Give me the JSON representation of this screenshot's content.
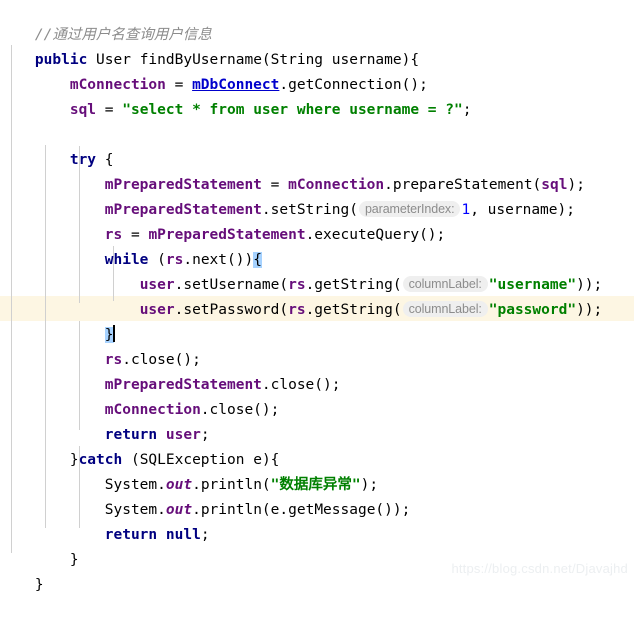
{
  "editor": {
    "language": "Java",
    "theme": "IntelliJ Light",
    "colors": {
      "background": "#ffffff",
      "keyword": "#000080",
      "string": "#008000",
      "number": "#0000ff",
      "field": "#660e7a",
      "comment": "#8c8c8c",
      "identifier": "#000000",
      "link": "#0000cc",
      "caret_line_highlight": "#fdf6e3",
      "brace_match_highlight": "#a6d2ff",
      "indent_guide": "#d0d0d0",
      "hint_chip_background": "#efefef",
      "hint_chip_text": "#8c8c8c",
      "watermark": "#eceff1"
    },
    "caret_line_number": 12,
    "matched_braces": [
      "{",
      "}"
    ]
  },
  "code": {
    "comment_line": "//通过用户名查询用户信息",
    "tokens": {
      "kw_public": "public",
      "kw_try": "try",
      "kw_while": "while",
      "kw_catch": "catch",
      "kw_return": "return",
      "kw_null": "null",
      "type_User": "User",
      "type_String": "String",
      "type_SQLException": "SQLException",
      "method_name": "findByUsername",
      "param_username": "username",
      "field_mConnection": "mConnection",
      "field_sql": "sql",
      "field_mPreparedStatement": "mPreparedStatement",
      "field_rs": "rs",
      "link_mDbConnect": "mDbConnect",
      "call_getConnection": ".getConnection();",
      "call_prepareStatement": ".prepareStatement(",
      "call_setString": ".setString(",
      "call_executeQuery": ".executeQuery();",
      "call_next": ".next())",
      "call_close": ".close();",
      "call_getString": ".getString(",
      "call_getMessage": "e.getMessage());",
      "var_user": "user",
      "var_e": "e",
      "sys_System": "System",
      "sys_out": "out",
      "sys_println": ".println(",
      "setUsername": ".setUsername(",
      "setPassword": ".setPassword(",
      "sql_string": "\"select * from user where username = ?\"",
      "str_username": "\"username\"",
      "str_password": "\"password\"",
      "str_db_error": "\"数据库异常\"",
      "num_one": "1"
    },
    "hints": {
      "parameter_index": "parameterIndex:",
      "column_label": "columnLabel:"
    },
    "lines": [
      "//通过用户名查询用户信息",
      "public User findByUsername(String username){",
      "    mConnection = mDbConnect.getConnection();",
      "    sql = \"select * from user where username = ?\";",
      "",
      "    try {",
      "        mPreparedStatement = mConnection.prepareStatement(sql);",
      "        mPreparedStatement.setString( parameterIndex: 1, username);",
      "        rs = mPreparedStatement.executeQuery();",
      "        while (rs.next()){",
      "            user.setUsername(rs.getString( columnLabel: \"username\"));",
      "            user.setPassword(rs.getString( columnLabel: \"password\"));",
      "        }",
      "        rs.close();",
      "        mPreparedStatement.close();",
      "        mConnection.close();",
      "        return user;",
      "    }catch (SQLException e){",
      "        System.out.println(\"数据库异常\");",
      "        System.out.println(e.getMessage());",
      "        return null;",
      "    }",
      "}"
    ]
  },
  "watermark": {
    "text": "https://blog.csdn.net/Djavajhd"
  }
}
